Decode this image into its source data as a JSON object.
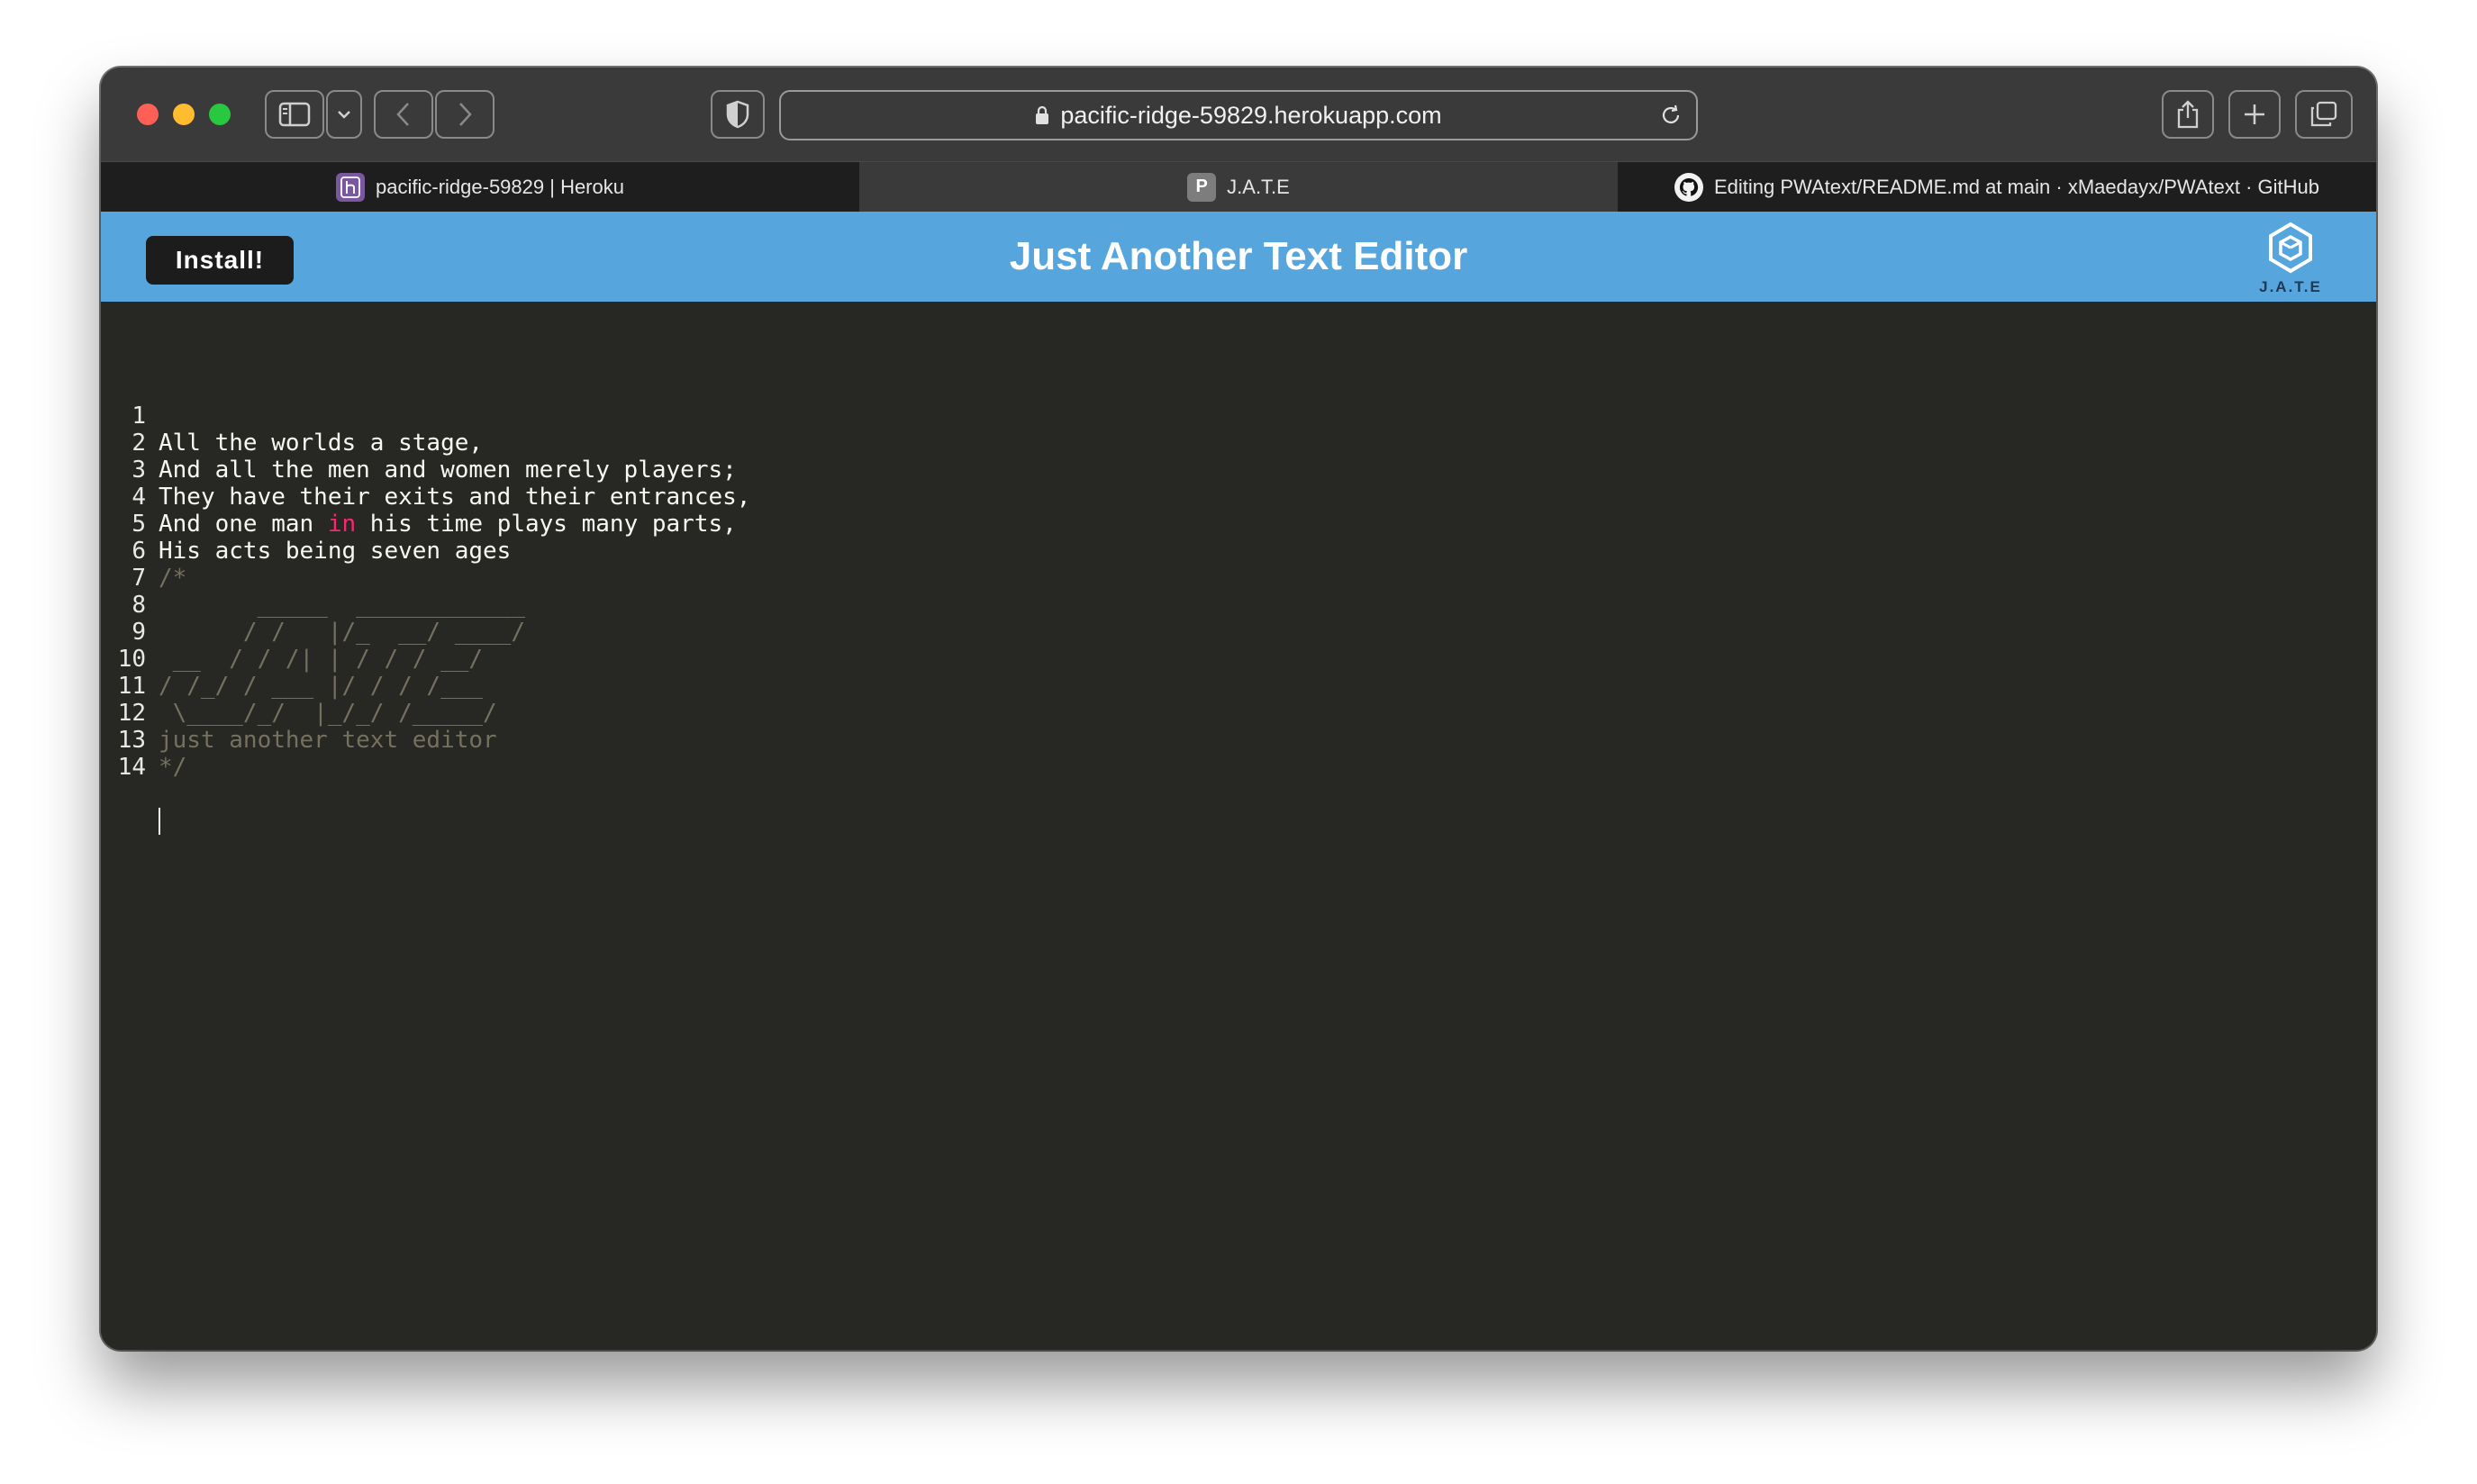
{
  "browser": {
    "url": "pacific-ridge-59829.herokuapp.com",
    "tabs": [
      {
        "label": "pacific-ridge-59829 | Heroku",
        "favicon": "heroku-icon",
        "active": false
      },
      {
        "label": "J.A.T.E",
        "favicon": "jate-icon",
        "favicon_letter": "P",
        "active": true
      },
      {
        "label": "Editing PWAtext/README.md at main · xMaedayx/PWAtext · GitHub",
        "favicon": "github-icon",
        "active": false
      }
    ]
  },
  "app": {
    "install_label": "Install!",
    "title": "Just Another Text Editor",
    "logo_text": "J.A.T.E",
    "header_color": "#56a5dc"
  },
  "editor": {
    "lines": [
      {
        "num": "1",
        "text": "All the worlds a stage,"
      },
      {
        "num": "2",
        "text": "And all the men and women merely players;"
      },
      {
        "num": "3",
        "text": "They have their exits and their entrances,"
      },
      {
        "num": "4",
        "pre": "And one man ",
        "keyword": "in",
        "post": " his time plays many parts,"
      },
      {
        "num": "5",
        "text": "His acts being seven ages"
      },
      {
        "num": "6",
        "text": "/*"
      },
      {
        "num": "7",
        "text": "       _____  ____________"
      },
      {
        "num": "8",
        "text": "      / /   |/_  __/ ____/"
      },
      {
        "num": "9",
        "text": " __  / / /| | / / / __/"
      },
      {
        "num": "10",
        "text": "/ /_/ / ___ |/ / / /___"
      },
      {
        "num": "11",
        "text": " \\____/_/  |_/_/ /_____/"
      },
      {
        "num": "12",
        "text": "just another text editor"
      },
      {
        "num": "13",
        "text": "*/"
      },
      {
        "num": "14",
        "text": ""
      }
    ],
    "background": "#272724",
    "text_color": "#f8f8f2",
    "comment_color": "#75715e",
    "keyword_color": "#f92672"
  }
}
